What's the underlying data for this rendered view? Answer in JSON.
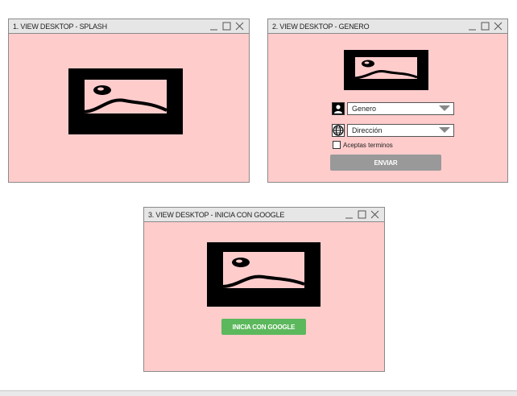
{
  "colors": {
    "window_bg": "#ffcccc",
    "titlebar_bg": "#e6e6e6",
    "disabled_button": "#999999",
    "google_button": "#5cb85c"
  },
  "windows": [
    {
      "title": "1. VIEW DESKTOP - SPLASH"
    },
    {
      "title": "2. VIEW DESKTOP - GENERO"
    },
    {
      "title": "3. VIEW DESKTOP - INICIA CON GOOGLE"
    }
  ],
  "genero_form": {
    "genero_select": {
      "value": "Genero",
      "icon": "user-icon"
    },
    "direccion_select": {
      "value": "Dirección",
      "icon": "globe-icon"
    },
    "terms_checkbox": {
      "label": "Aceptas terminos",
      "checked": false
    },
    "submit_button": "ENVIAR"
  },
  "google_login": {
    "button_label": "INICIA CON GOOGLE"
  }
}
